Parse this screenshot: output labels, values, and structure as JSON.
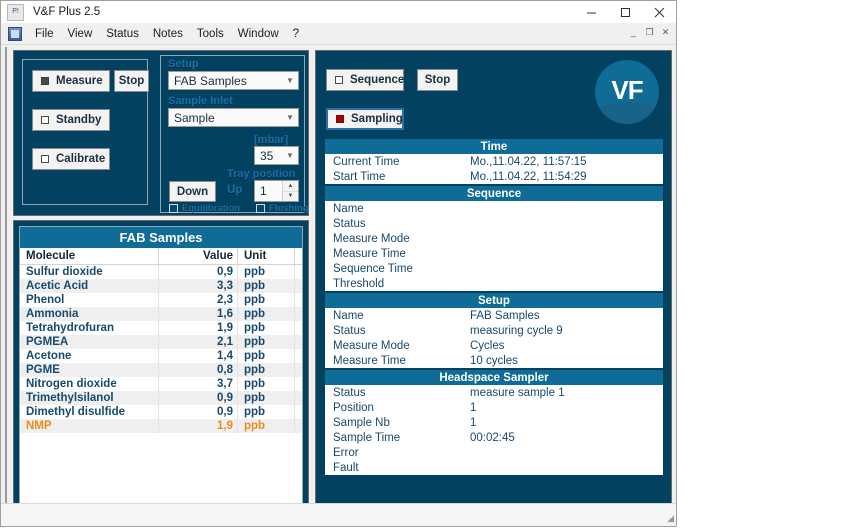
{
  "window": {
    "title": "V&F Plus 2.5",
    "app_icon_text": "P!",
    "controls": {
      "minimize": "–",
      "maximize": "☐",
      "close": "✕"
    },
    "mdi_controls": {
      "minimize": "_",
      "restore": "❐",
      "close": "✕"
    }
  },
  "menu": {
    "items": [
      "File",
      "View",
      "Status",
      "Notes",
      "Tools",
      "Window",
      "?"
    ]
  },
  "mode_panel": {
    "buttons": [
      {
        "label": "Measure",
        "indicator": "on",
        "name": "measure-button"
      },
      {
        "label": "Stop",
        "indicator": "none",
        "name": "stop-measure-button"
      },
      {
        "label": "Standby",
        "indicator": "off",
        "name": "standby-button"
      },
      {
        "label": "Calibrate",
        "indicator": "off",
        "name": "calibrate-button"
      }
    ]
  },
  "setup_panel": {
    "setup_label": "Setup",
    "setup_value": "FAB Samples",
    "inlet_label": "Sample Inlet",
    "inlet_value": "Sample",
    "pressure_label": "[mbar]",
    "pressure_value": "35",
    "tray_label": "Tray position",
    "tray_value": "1",
    "down_button": "Down",
    "up_label": "Up",
    "equilibration_label": "Equilibration",
    "flushing_label": "Flushing"
  },
  "samples_table": {
    "title": "FAB Samples",
    "columns": [
      "Molecule",
      "Value",
      "Unit",
      ""
    ],
    "rows": [
      {
        "molecule": "Sulfur dioxide",
        "value": "0,9",
        "unit": "ppb",
        "highlight": false
      },
      {
        "molecule": "Acetic Acid",
        "value": "3,3",
        "unit": "ppb",
        "highlight": false
      },
      {
        "molecule": "Phenol",
        "value": "2,3",
        "unit": "ppb",
        "highlight": false
      },
      {
        "molecule": "Ammonia",
        "value": "1,6",
        "unit": "ppb",
        "highlight": false
      },
      {
        "molecule": "Tetrahydrofuran",
        "value": "1,9",
        "unit": "ppb",
        "highlight": false
      },
      {
        "molecule": "PGMEA",
        "value": "2,1",
        "unit": "ppb",
        "highlight": false
      },
      {
        "molecule": "Acetone",
        "value": "1,4",
        "unit": "ppb",
        "highlight": false
      },
      {
        "molecule": "PGME",
        "value": "0,8",
        "unit": "ppb",
        "highlight": false
      },
      {
        "molecule": "Nitrogen dioxide",
        "value": "3,7",
        "unit": "ppb",
        "highlight": false
      },
      {
        "molecule": "Trimethylsilanol",
        "value": "0,9",
        "unit": "ppb",
        "highlight": false
      },
      {
        "molecule": "Dimethyl disulfide",
        "value": "0,9",
        "unit": "ppb",
        "highlight": false
      },
      {
        "molecule": "NMP",
        "value": "1,9",
        "unit": "ppb",
        "highlight": true
      }
    ]
  },
  "sequence_panel": {
    "buttons": [
      {
        "label": "Sequence",
        "indicator": "off",
        "name": "sequence-button"
      },
      {
        "label": "Stop",
        "indicator": "none",
        "name": "stop-sequence-button"
      },
      {
        "label": "Sampling",
        "indicator": "red",
        "name": "sampling-button"
      }
    ],
    "logo_text": "VF"
  },
  "info_sections": [
    {
      "title": "Time",
      "rows": [
        {
          "key": "Current Time",
          "value": "Mo.,11.04.22, 11:57:15"
        },
        {
          "key": "Start Time",
          "value": "Mo.,11.04.22, 11:54:29"
        }
      ]
    },
    {
      "title": "Sequence",
      "rows": [
        {
          "key": "Name",
          "value": ""
        },
        {
          "key": "Status",
          "value": ""
        },
        {
          "key": "Measure Mode",
          "value": ""
        },
        {
          "key": "Measure Time",
          "value": ""
        },
        {
          "key": "Sequence Time",
          "value": ""
        },
        {
          "key": "Threshold",
          "value": ""
        }
      ]
    },
    {
      "title": "Setup",
      "rows": [
        {
          "key": "Name",
          "value": "FAB Samples"
        },
        {
          "key": "Status",
          "value": "measuring cycle 9"
        },
        {
          "key": "Measure Mode",
          "value": "Cycles"
        },
        {
          "key": "Measure Time",
          "value": "10 cycles"
        }
      ]
    },
    {
      "title": "Headspace Sampler",
      "rows": [
        {
          "key": "Status",
          "value": "measure sample 1"
        },
        {
          "key": "Position",
          "value": "1"
        },
        {
          "key": "Sample Nb",
          "value": "1"
        },
        {
          "key": "Sample Time",
          "value": "00:02:45"
        },
        {
          "key": "Error",
          "value": ""
        },
        {
          "key": "Fault",
          "value": ""
        }
      ]
    }
  ],
  "colors": {
    "panel_bg": "#034161",
    "section_header": "#0f6c96",
    "label_blue": "#1a6fa8",
    "text_blue": "#17496e",
    "highlight_orange": "#f08a1e",
    "indicator_red": "#b10000"
  }
}
